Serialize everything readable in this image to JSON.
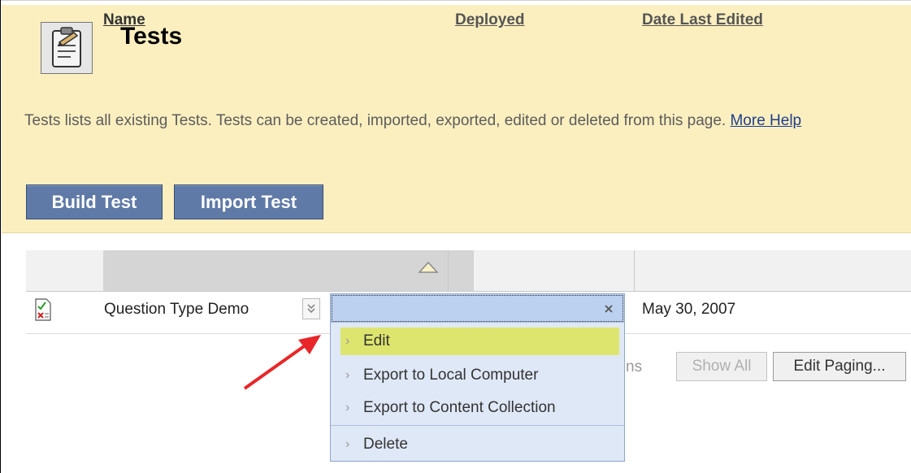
{
  "page": {
    "title": "Tests",
    "description": "Tests lists all existing Tests. Tests can be created, imported, exported, edited or deleted from this page.",
    "help_link": "More Help"
  },
  "buttons": {
    "build": "Build Test",
    "import": "Import Test"
  },
  "table": {
    "headers": [
      "Name",
      "Deployed",
      "Date Last Edited"
    ],
    "sorted_column": "Name",
    "rows": [
      {
        "name": "Question Type Demo",
        "deployed": "",
        "date_last_edited": "May 30, 2007"
      }
    ]
  },
  "paging": {
    "partial_label": "ns",
    "show_all": "Show All",
    "edit_paging": "Edit Paging..."
  },
  "context_menu": {
    "items": [
      {
        "label": "Edit",
        "highlighted": true
      },
      {
        "label": "Export to Local Computer"
      },
      {
        "label": "Export to Content Collection"
      },
      {
        "label": "Delete"
      }
    ]
  },
  "colors": {
    "header_bg": "#fbefbf",
    "button_bg": "#607aa8",
    "menu_bg": "#dfe8f6",
    "highlight": "#dde56e",
    "annotation_arrow": "#e8262a"
  }
}
